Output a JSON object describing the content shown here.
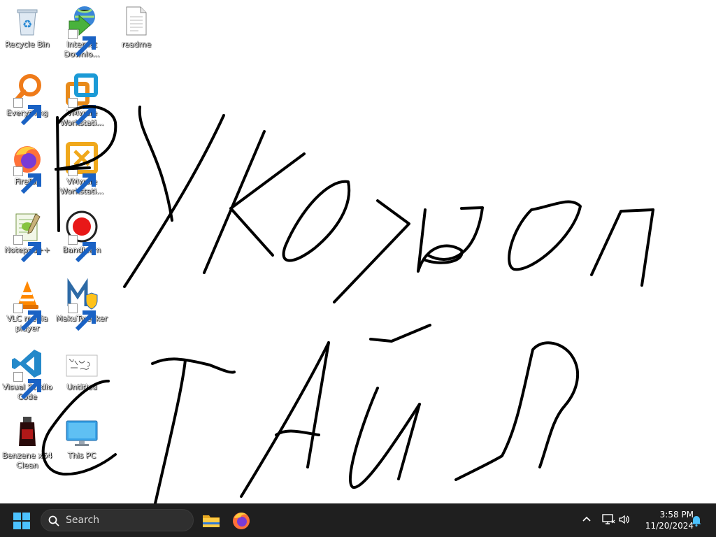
{
  "desktop": {
    "icons": [
      {
        "label": "Recycle Bin",
        "icon": "recycle-bin-icon",
        "shortcut": false
      },
      {
        "label": "Internet Downlo...",
        "icon": "internet-download-manager-icon",
        "shortcut": true
      },
      {
        "label": "readme",
        "icon": "text-document-icon",
        "shortcut": false
      },
      {
        "label": "Everything",
        "icon": "everything-search-icon",
        "shortcut": true
      },
      {
        "label": "VMware Workstati...",
        "icon": "vmware-workstation-icon",
        "shortcut": true
      },
      {
        "label": "Firefox",
        "icon": "firefox-icon",
        "shortcut": true
      },
      {
        "label": "VMware Workstati...",
        "icon": "vmware-workstation-player-icon",
        "shortcut": true
      },
      {
        "label": "Notepad++",
        "icon": "notepad-plus-plus-icon",
        "shortcut": true
      },
      {
        "label": "Bandicam",
        "icon": "bandicam-icon",
        "shortcut": true
      },
      {
        "label": "VLC media player",
        "icon": "vlc-icon",
        "shortcut": true
      },
      {
        "label": "MakuTweaker",
        "icon": "makutweaker-icon",
        "shortcut": true
      },
      {
        "label": "Visual Studio Code",
        "icon": "vscode-icon",
        "shortcut": true
      },
      {
        "label": "Untitled",
        "icon": "image-file-icon",
        "shortcut": false
      },
      {
        "label": "Benzene x64 Clean",
        "icon": "benzene-icon",
        "shortcut": false
      },
      {
        "label": "This PC",
        "icon": "this-pc-icon",
        "shortcut": false
      }
    ]
  },
  "taskbar": {
    "search_placeholder": "Search",
    "pinned": [
      "file-explorer-icon",
      "firefox-icon"
    ],
    "time": "3:58 PM",
    "date": "11/20/2024"
  },
  "colors": {
    "taskbar_bg": "#1f1f1f",
    "start_blue": "#4cc2ff",
    "ink": "#000000"
  }
}
